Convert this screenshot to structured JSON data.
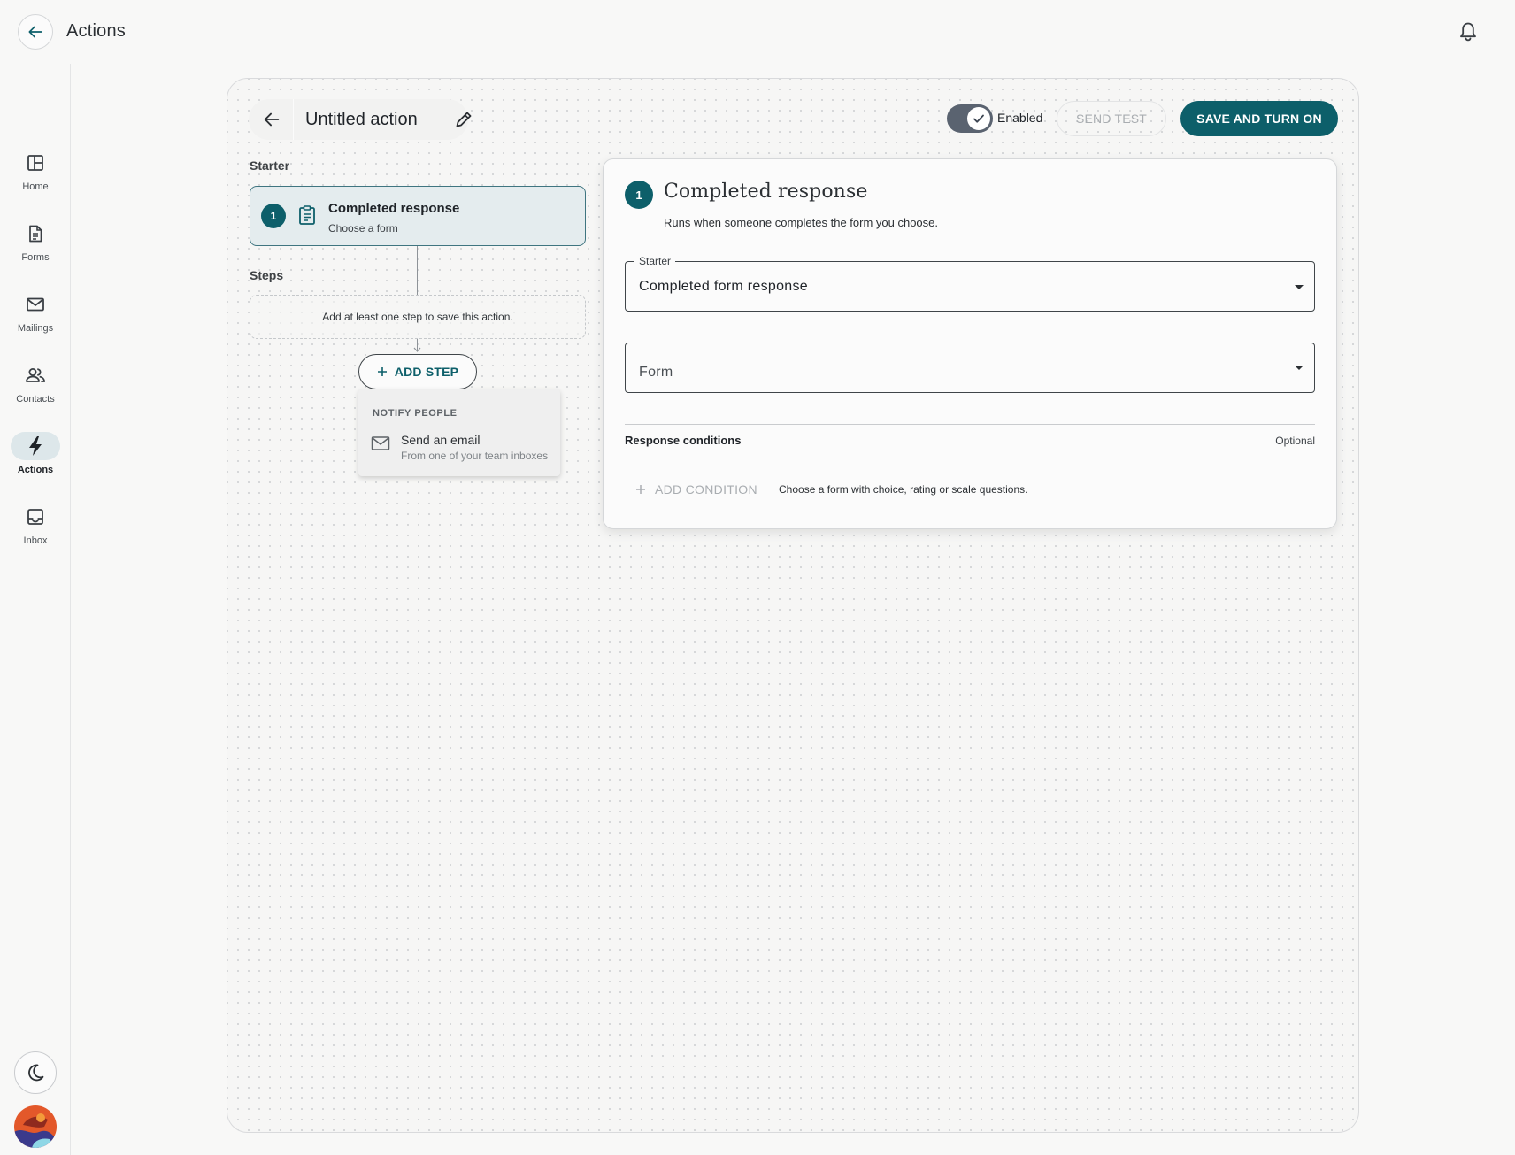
{
  "app": {
    "title": "Actions"
  },
  "nav": {
    "items": [
      {
        "label": "Home",
        "icon": "home-icon"
      },
      {
        "label": "Forms",
        "icon": "forms-icon"
      },
      {
        "label": "Mailings",
        "icon": "mail-icon"
      },
      {
        "label": "Contacts",
        "icon": "contacts-icon"
      },
      {
        "label": "Actions",
        "icon": "bolt-icon",
        "active": true
      },
      {
        "label": "Inbox",
        "icon": "inbox-icon"
      }
    ]
  },
  "editor": {
    "action_title": "Untitled action",
    "toggle": {
      "label": "Enabled",
      "on": true
    },
    "send_test_label": "SEND TEST",
    "save_label": "SAVE AND TURN ON"
  },
  "workflow": {
    "starter_label": "Starter",
    "starter_card": {
      "number": "1",
      "title": "Completed response",
      "subtitle": "Choose a form"
    },
    "steps_label": "Steps",
    "steps_empty": "Add at least one step to save this action.",
    "add_step_label": "ADD STEP",
    "menu": {
      "heading": "NOTIFY PEOPLE",
      "items": [
        {
          "title": "Send an email",
          "subtitle": "From one of your team inboxes",
          "icon": "mail-icon"
        }
      ]
    }
  },
  "panel": {
    "number": "1",
    "title": "Completed response",
    "description": "Runs when someone completes the form you choose.",
    "starter_field": {
      "label": "Starter",
      "value": "Completed form response"
    },
    "form_field": {
      "placeholder": "Form"
    },
    "conditions": {
      "title": "Response conditions",
      "optional": "Optional",
      "add_label": "ADD CONDITION",
      "hint": "Choose a form with choice, rating or scale questions."
    }
  },
  "colors": {
    "accent": "#0d5f6a",
    "toggle_track": "#5a6370",
    "selected_card_bg": "#e4ecee",
    "active_nav_bg": "#dde7ea"
  }
}
